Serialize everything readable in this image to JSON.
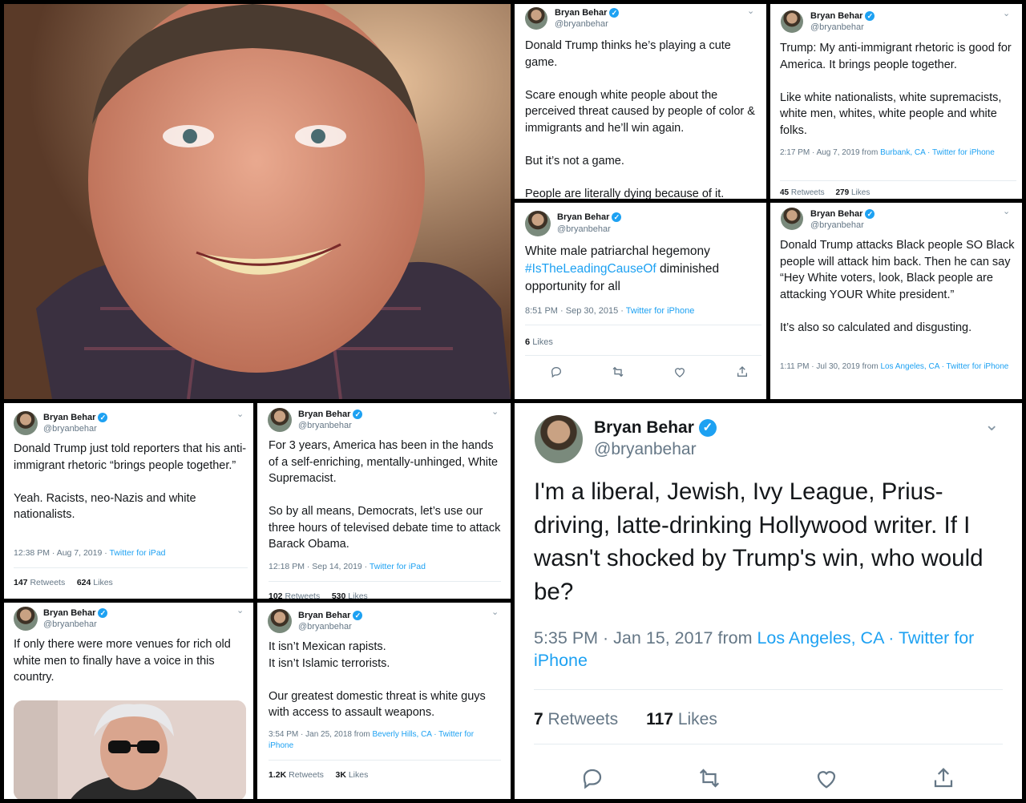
{
  "author": {
    "name": "Bryan Behar",
    "handle": "@bryanbehar"
  },
  "tweets": {
    "t1": {
      "text": "Donald Trump thinks he’s playing a cute game.\n\nScare enough white people about the perceived threat caused by people of color & immigrants and he’ll win again.\n\nBut it’s not a game.\n\nPeople are literally dying because of it."
    },
    "t2": {
      "text": "Trump: My anti-immigrant rhetoric is good for America. It brings people together.\n\nLike white nationalists, white supremacists, white men, whites, white people and white folks.",
      "time": "2:17 PM · Aug 7, 2019 from ",
      "location": "Burbank, CA",
      "source": " · Twitter for iPhone",
      "retweets": "45",
      "retweets_label": "Retweets",
      "likes": "279",
      "likes_label": "Likes"
    },
    "t3": {
      "text_before": "White male patriarchal hegemony ",
      "hashtag": "#IsTheLeadingCauseOf",
      "text_after": " diminished opportunity for all",
      "time": "8:51 PM · Sep 30, 2015 · ",
      "source": "Twitter for iPhone",
      "likes": "6",
      "likes_label": "Likes"
    },
    "t4": {
      "text": "Donald Trump attacks Black people SO Black people will attack him back. Then he can say “Hey White voters, look, Black people are attacking YOUR White president.”\n\nIt’s also so calculated and disgusting.",
      "time": "1:11 PM · Jul 30, 2019 from ",
      "location": "Los Angeles, CA",
      "source": " · Twitter for iPhone"
    },
    "t5": {
      "text": "Donald Trump just told reporters that his anti-immigrant rhetoric “brings people together.”\n\nYeah. Racists, neo-Nazis and white nationalists.",
      "time": "12:38 PM · Aug 7, 2019 · ",
      "source": "Twitter for iPad",
      "retweets": "147",
      "retweets_label": "Retweets",
      "likes": "624",
      "likes_label": "Likes"
    },
    "t6": {
      "text": "For 3 years, America has been in the hands of a self-enriching, mentally-unhinged, White Supremacist.\n\nSo by all means, Democrats, let’s use our three hours of televised debate time to attack Barack Obama.",
      "time": "12:18 PM · Sep 14, 2019 · ",
      "source": "Twitter for iPad",
      "retweets": "102",
      "retweets_label": "Retweets",
      "likes": "530",
      "likes_label": "Likes"
    },
    "t7": {
      "text": "If only there were more venues for rich old white men to finally have a voice in this country."
    },
    "t8": {
      "text": "It isn’t Mexican rapists.\nIt isn’t Islamic terrorists.\n\nOur greatest domestic threat is white guys with access to assault weapons.",
      "time": "3:54 PM · Jan 25, 2018 from ",
      "location": "Beverly Hills, CA",
      "source": " · Twitter for iPhone",
      "retweets": "1.2K",
      "retweets_label": "Retweets",
      "likes": "3K",
      "likes_label": "Likes"
    },
    "t9": {
      "text": "I'm a liberal, Jewish, Ivy League, Prius-driving, latte-drinking Hollywood writer. If I wasn't shocked by Trump's win, who would be?",
      "time": "5:35 PM · Jan 15, 2017 from ",
      "location": "Los Angeles, CA",
      "source": " · Twitter for iPhone",
      "retweets": "7",
      "retweets_label": "Retweets",
      "likes": "117",
      "likes_label": "Likes"
    }
  },
  "icons": {
    "reply": "reply-icon",
    "retweet": "retweet-icon",
    "like": "heart-icon",
    "share": "share-icon",
    "menu": "chevron-down-icon",
    "verified": "verified-badge-icon"
  },
  "colors": {
    "link": "#1da1f2",
    "muted": "#657786",
    "text": "#14171a"
  }
}
